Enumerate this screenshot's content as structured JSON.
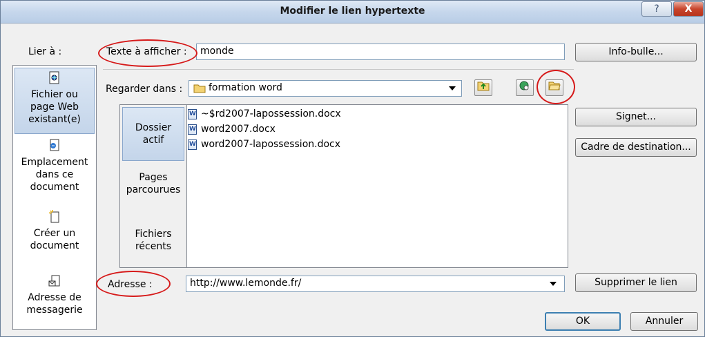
{
  "window": {
    "title": "Modifier le lien hypertexte",
    "help_glyph": "?",
    "close_glyph": "X"
  },
  "link_to": {
    "label": "Lier à :",
    "items": [
      {
        "label": "Fichier ou\npage Web\nexistant(e)",
        "icon": "web-file-icon",
        "active": true
      },
      {
        "label": "Emplacement\ndans ce\ndocument",
        "icon": "document-place-icon",
        "active": false
      },
      {
        "label": "Créer un\ndocument",
        "icon": "new-document-icon",
        "active": false
      },
      {
        "label": "Adresse de\nmessagerie",
        "icon": "email-icon",
        "active": false
      }
    ]
  },
  "display_text": {
    "label": "Texte à afficher :",
    "value": "monde"
  },
  "screentip_button": "Info-bulle...",
  "look_in": {
    "label": "Regarder dans :",
    "value": "formation word"
  },
  "sub_tabs": [
    {
      "label": "Dossier\nactif",
      "active": true
    },
    {
      "label": "Pages\nparcourues",
      "active": false
    },
    {
      "label": "Fichiers\nrécents",
      "active": false
    }
  ],
  "files": [
    "~$rd2007-lapossession.docx",
    "word2007.docx",
    "word2007-lapossession.docx"
  ],
  "right_buttons": {
    "bookmark": "Signet...",
    "target_frame": "Cadre de destination...",
    "remove_link": "Supprimer le lien"
  },
  "address": {
    "label": "Adresse :",
    "value": "http://www.lemonde.fr/"
  },
  "footer": {
    "ok": "OK",
    "cancel": "Annuler"
  },
  "colors": {
    "highlight_circle": "#d61a1a",
    "active_item_bg": "#c4d5ea"
  }
}
